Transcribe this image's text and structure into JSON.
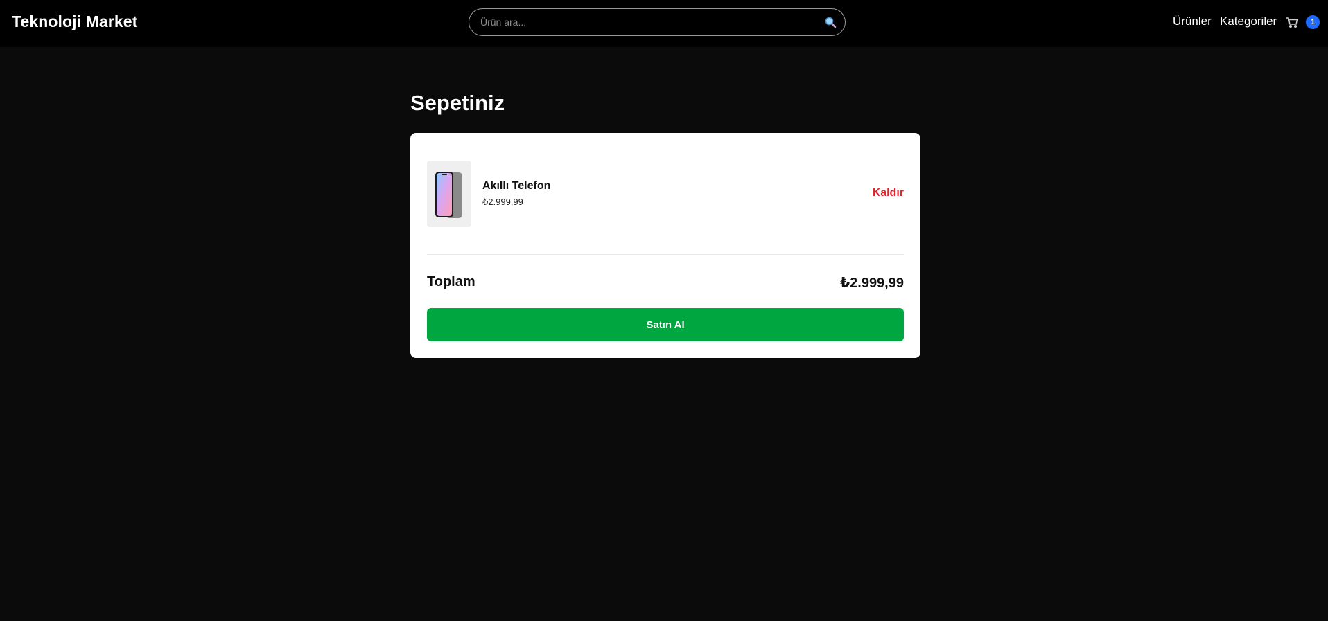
{
  "header": {
    "brand": "Teknoloji Market",
    "search": {
      "placeholder": "Ürün ara...",
      "value": "",
      "icon": "search-icon"
    },
    "nav": {
      "products": "Ürünler",
      "categories": "Kategoriler"
    },
    "cart": {
      "icon": "cart-icon",
      "count": "1",
      "badge_color": "#1e6bff"
    }
  },
  "cart_page": {
    "title": "Sepetiniz",
    "items": [
      {
        "name": "Akıllı Telefon",
        "price": "₺2.999,99",
        "image": "smartphone-image",
        "remove_label": "Kaldır"
      }
    ],
    "total_label": "Toplam",
    "total_value": "₺2.999,99",
    "checkout_label": "Satın Al"
  },
  "colors": {
    "background": "#0b0b0b",
    "header": "#000000",
    "card": "#ffffff",
    "buy_button": "#00a640",
    "remove": "#e5232d"
  }
}
